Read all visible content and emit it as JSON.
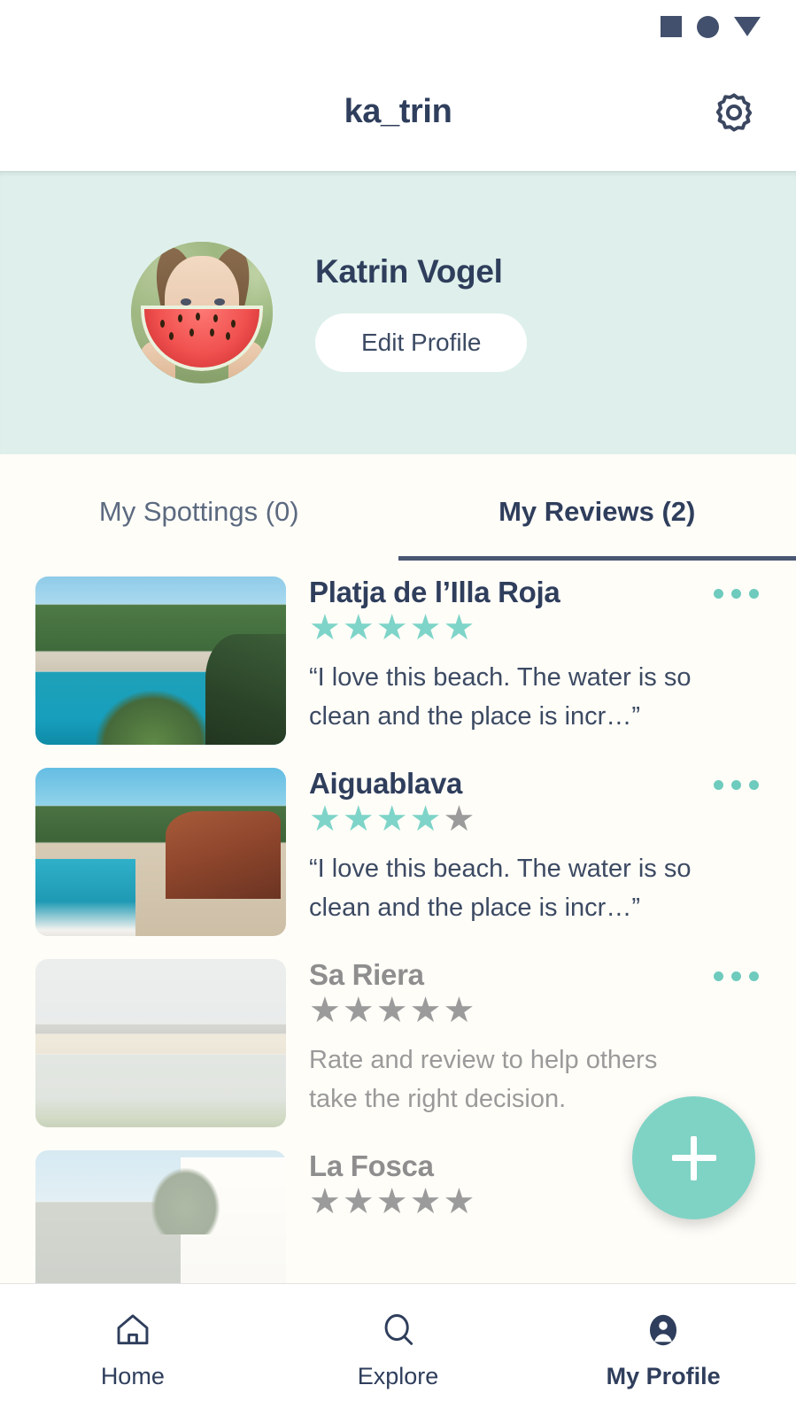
{
  "status_bar": {
    "icons": [
      "square-icon",
      "circle-icon",
      "triangle-down-icon"
    ]
  },
  "app_bar": {
    "title": "ka_trin",
    "settings_icon": "gear-icon"
  },
  "profile": {
    "name": "Katrin Vogel",
    "edit_button": "Edit Profile",
    "avatar_alt": "avatar",
    "banner_color": "#dff0ec"
  },
  "tabs": [
    {
      "label": "My Spottings (0)",
      "active": false
    },
    {
      "label": "My Reviews (2)",
      "active": true
    }
  ],
  "reviews": [
    {
      "title": "Platja de l’Illa Roja",
      "rating": 5,
      "max_rating": 5,
      "text": "“I love this beach. The water is so clean and the place is incr…”",
      "rated": true,
      "menu_icon": "more-options-icon"
    },
    {
      "title": "Aiguablava",
      "rating": 4,
      "max_rating": 5,
      "text": "“I love this beach. The water is so clean and the place is incr…”",
      "rated": true,
      "menu_icon": "more-options-icon"
    },
    {
      "title": "Sa Riera",
      "rating": 0,
      "max_rating": 5,
      "text": "Rate and review to help others take the right decision.",
      "rated": false,
      "menu_icon": "more-options-icon"
    },
    {
      "title": "La Fosca",
      "rating": 0,
      "max_rating": 5,
      "text": "",
      "rated": false,
      "menu_icon": "more-options-icon"
    }
  ],
  "fab": {
    "icon": "plus-icon",
    "label": "Add"
  },
  "bottom_nav": [
    {
      "label": "Home",
      "icon": "home-icon",
      "active": false
    },
    {
      "label": "Explore",
      "icon": "search-icon",
      "active": false
    },
    {
      "label": "My Profile",
      "icon": "person-icon",
      "active": true
    }
  ],
  "colors": {
    "accent_teal": "#7ed4c8",
    "text_navy": "#2f3e5c",
    "muted_grey": "#9b9b9b",
    "page_bg": "#fffdf8"
  },
  "star_glyph": "★"
}
